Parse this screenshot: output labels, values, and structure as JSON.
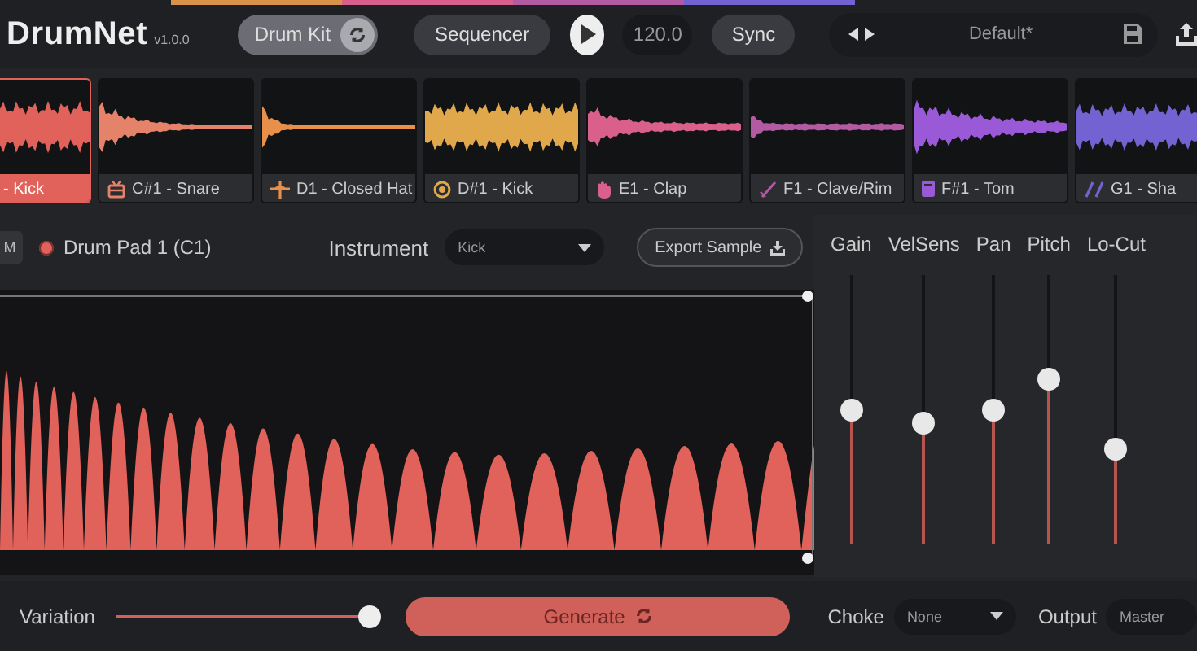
{
  "app": {
    "name": "DrumNet",
    "version": "v1.0.0"
  },
  "toolbar": {
    "drum_kit": {
      "label": "Drum Kit",
      "on": true
    },
    "sequencer": "Sequencer",
    "tempo": "120.0",
    "sync": "Sync",
    "preset": "Default*"
  },
  "pads": [
    {
      "label": "- Kick",
      "color": "#e0625a",
      "selected": true,
      "kind": "none"
    },
    {
      "label": "C#1 - Snare",
      "color": "#e5826a",
      "selected": false,
      "kind": "snare"
    },
    {
      "label": "D1 - Closed Hat",
      "color": "#e8904a",
      "selected": false,
      "kind": "hat"
    },
    {
      "label": "D#1 - Kick",
      "color": "#e0a84a",
      "selected": false,
      "kind": "kick"
    },
    {
      "label": "E1 - Clap",
      "color": "#d9608a",
      "selected": false,
      "kind": "clap"
    },
    {
      "label": "F1 - Clave/Rim",
      "color": "#b25aa2",
      "selected": false,
      "kind": "rim"
    },
    {
      "label": "F#1 - Tom",
      "color": "#9a5ad8",
      "selected": false,
      "kind": "tom"
    },
    {
      "label": "G1 - Sha",
      "color": "#7262d2",
      "selected": false,
      "kind": "shaker"
    }
  ],
  "instrument_bar": {
    "mute": "M",
    "pad_name": "Drum Pad 1 (C1)",
    "instrument_label": "Instrument",
    "instrument": "Kick",
    "export": "Export Sample"
  },
  "faders": [
    {
      "label": "Gain",
      "level": 0.5
    },
    {
      "label": "VelSens",
      "level": 0.45
    },
    {
      "label": "Pan",
      "level": 0.5
    },
    {
      "label": "Pitch",
      "level": 0.61
    },
    {
      "label": "Lo-Cut",
      "level": 0.35
    }
  ],
  "bottom": {
    "variation_label": "Variation",
    "variation": {
      "level": 0.97
    },
    "generate": "Generate",
    "choke_label": "Choke",
    "choke": "None",
    "output_label": "Output",
    "output": "Master"
  }
}
